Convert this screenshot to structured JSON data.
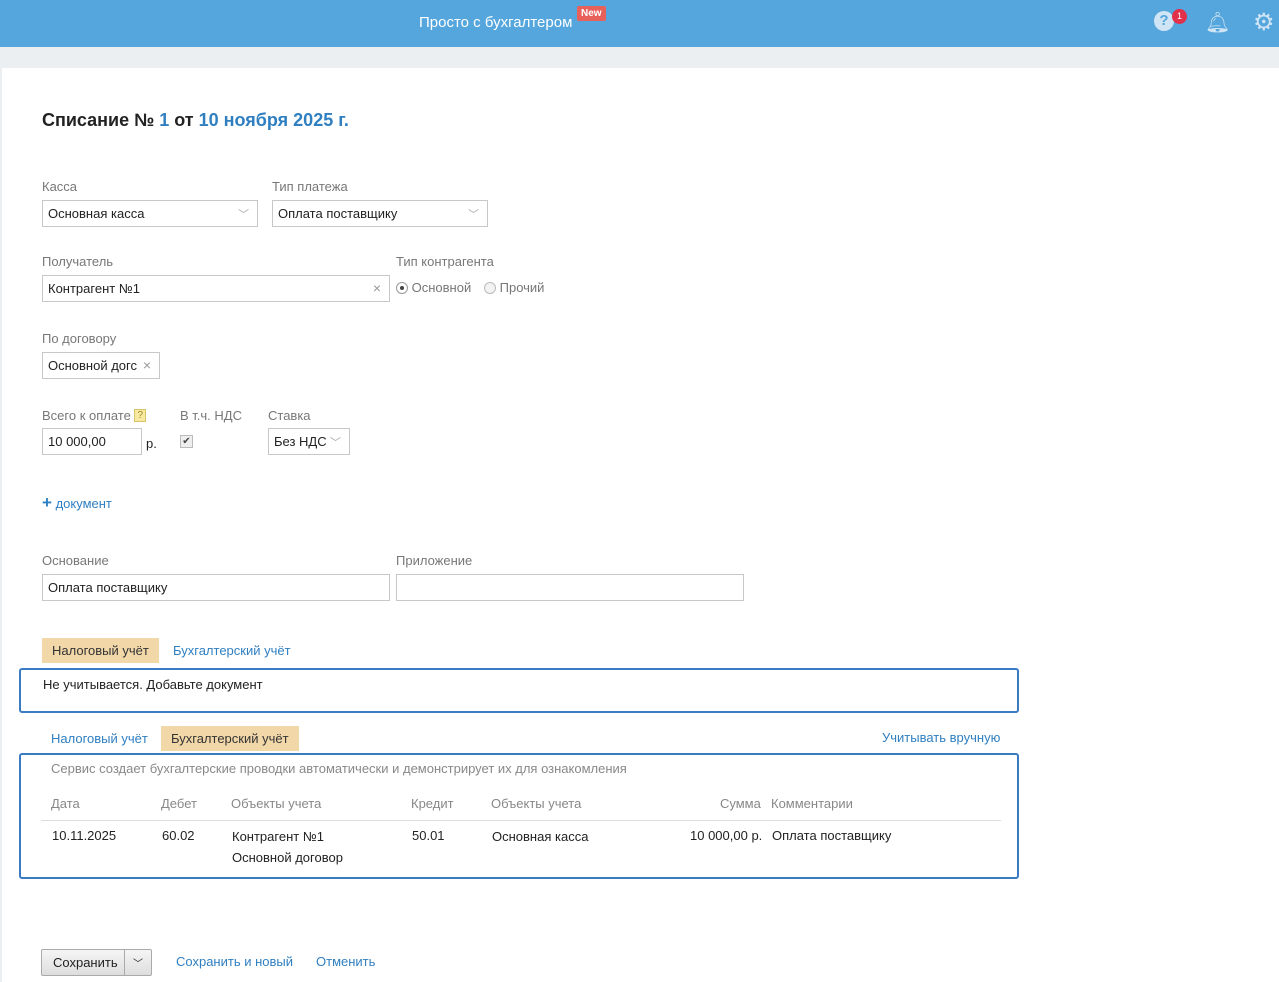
{
  "header": {
    "brand": "Просто с бухгалтером",
    "new_badge": "New",
    "help_count": "1"
  },
  "doc": {
    "title_prefix": "Списание №",
    "number": "1",
    "title_mid": "от",
    "date": "10 ноября 2025 г."
  },
  "form": {
    "kassa_label": "Касса",
    "kassa_value": "Основная касса",
    "payment_type_label": "Тип платежа",
    "payment_type_value": "Оплата поставщику",
    "recipient_label": "Получатель",
    "recipient_value": "Контрагент №1",
    "counterparty_type_label": "Тип контрагента",
    "radio_main": "Основной",
    "radio_other": "Прочий",
    "contract_label": "По договору",
    "contract_value": "Основной догс",
    "total_label": "Всего к оплате",
    "total_help": "?",
    "total_value": "10 000,00",
    "currency": "р.",
    "vat_included_label": "В т.ч. НДС",
    "rate_label": "Ставка",
    "rate_value": "Без НДС",
    "add_document": "документ",
    "basis_label": "Основание",
    "basis_value": "Оплата поставщику",
    "attachment_label": "Приложение",
    "attachment_value": ""
  },
  "tax_tabs": {
    "tax": "Налоговый учёт",
    "accounting": "Бухгалтерский учёт",
    "message": "Не учитывается. Добавьте документ"
  },
  "acc_tabs": {
    "tax": "Налоговый учёт",
    "accounting": "Бухгалтерский учёт",
    "manual": "Учитывать вручную",
    "info": "Сервис создает бухгалтерские проводки автоматически и демонстрирует их для ознакомления",
    "headers": [
      "Дата",
      "Дебет",
      "Объекты учета",
      "Кредит",
      "Объекты учета",
      "Сумма",
      "Комментарии"
    ],
    "rows": [
      {
        "date": "10.11.2025",
        "debit": "60.02",
        "debit_obj1": "Контрагент №1",
        "debit_obj2": "Основной договор",
        "credit": "50.01",
        "credit_obj": "Основная касса",
        "sum": "10 000,00 р.",
        "comment": "Оплата поставщику"
      }
    ]
  },
  "footer": {
    "save": "Сохранить",
    "save_new": "Сохранить и новый",
    "cancel": "Отменить"
  }
}
